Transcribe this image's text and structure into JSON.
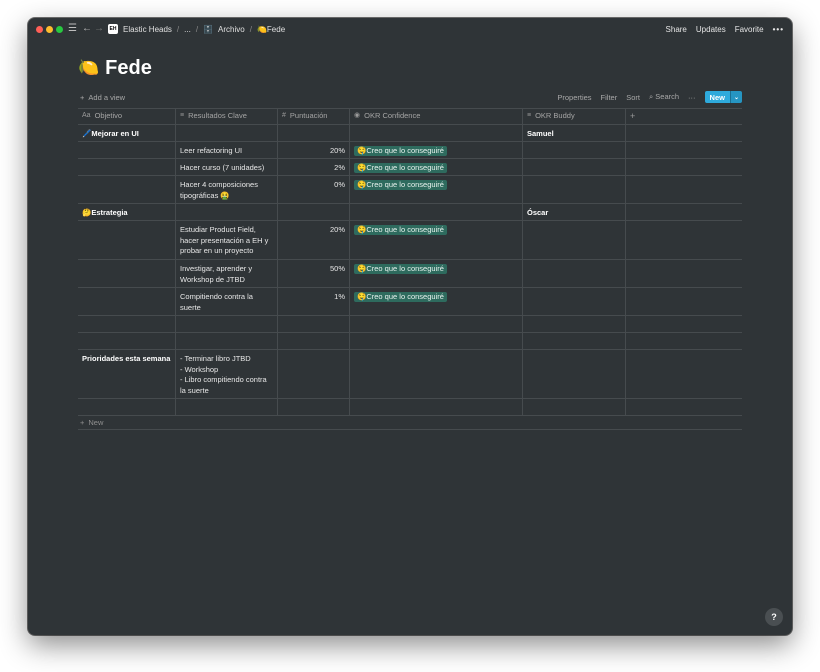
{
  "titlebar": {
    "workspace_logo": "EH",
    "breadcrumbs": [
      "Elastic Heads",
      "...",
      "Archivo",
      "Fede"
    ],
    "archivo_icon": "file-cabinet-icon",
    "fede_emoji": "🍋",
    "actions": [
      "Share",
      "Updates",
      "Favorite"
    ]
  },
  "page": {
    "emoji": "🍋",
    "title": "Fede"
  },
  "toolbar": {
    "add_view": "Add a view",
    "properties": "Properties",
    "filter": "Filter",
    "sort": "Sort",
    "search": "Search",
    "new": "New"
  },
  "table": {
    "columns": [
      "Objetivo",
      "Resultados Clave",
      "Puntuación",
      "OKR Confidence",
      "OKR Buddy"
    ],
    "rows": [
      {
        "objetivo": "🖊️Mejorar en UI",
        "resultado": "",
        "puntuacion": "",
        "confidence": "",
        "buddy": "Samuel"
      },
      {
        "objetivo": "",
        "resultado": "Leer refactoring UI",
        "puntuacion": "20%",
        "confidence": "🤤Creo que lo conseguiré",
        "buddy": ""
      },
      {
        "objetivo": "",
        "resultado": "Hacer curso (7 unidades)",
        "puntuacion": "2%",
        "confidence": "🤤Creo que lo conseguiré",
        "buddy": ""
      },
      {
        "objetivo": "",
        "resultado": "Hacer 4 composiciones tipográficas 🤮",
        "puntuacion": "0%",
        "confidence": "🤤Creo que lo conseguiré",
        "buddy": ""
      },
      {
        "objetivo": "🤔Estrategia",
        "resultado": "",
        "puntuacion": "",
        "confidence": "",
        "buddy": "Óscar"
      },
      {
        "objetivo": "",
        "resultado": "Estudiar Product Field, hacer presentación a EH y probar en un proyecto",
        "puntuacion": "20%",
        "confidence": "🤤Creo que lo conseguiré",
        "buddy": ""
      },
      {
        "objetivo": "",
        "resultado": "Investigar, aprender y Workshop de JTBD",
        "puntuacion": "50%",
        "confidence": "🤤Creo que lo conseguiré",
        "buddy": ""
      },
      {
        "objetivo": "",
        "resultado": "Compitiendo contra la suerte",
        "puntuacion": "1%",
        "confidence": "🤤Creo que lo conseguiré",
        "buddy": ""
      },
      {
        "objetivo": "",
        "resultado": "",
        "puntuacion": "",
        "confidence": "",
        "buddy": ""
      },
      {
        "objetivo": "",
        "resultado": "",
        "puntuacion": "",
        "confidence": "",
        "buddy": ""
      },
      {
        "objetivo": "Prioridades esta semana",
        "resultado": "- Terminar libro JTBD\n- Workshop\n- Libro compitiendo contra la suerte",
        "puntuacion": "",
        "confidence": "",
        "buddy": ""
      },
      {
        "objetivo": "",
        "resultado": "",
        "puntuacion": "",
        "confidence": "",
        "buddy": ""
      }
    ],
    "new_row": "New"
  },
  "help": "?",
  "colors": {
    "background": "#2f3437",
    "tag": "#2e6b5e",
    "accent": "#2eaadc"
  }
}
